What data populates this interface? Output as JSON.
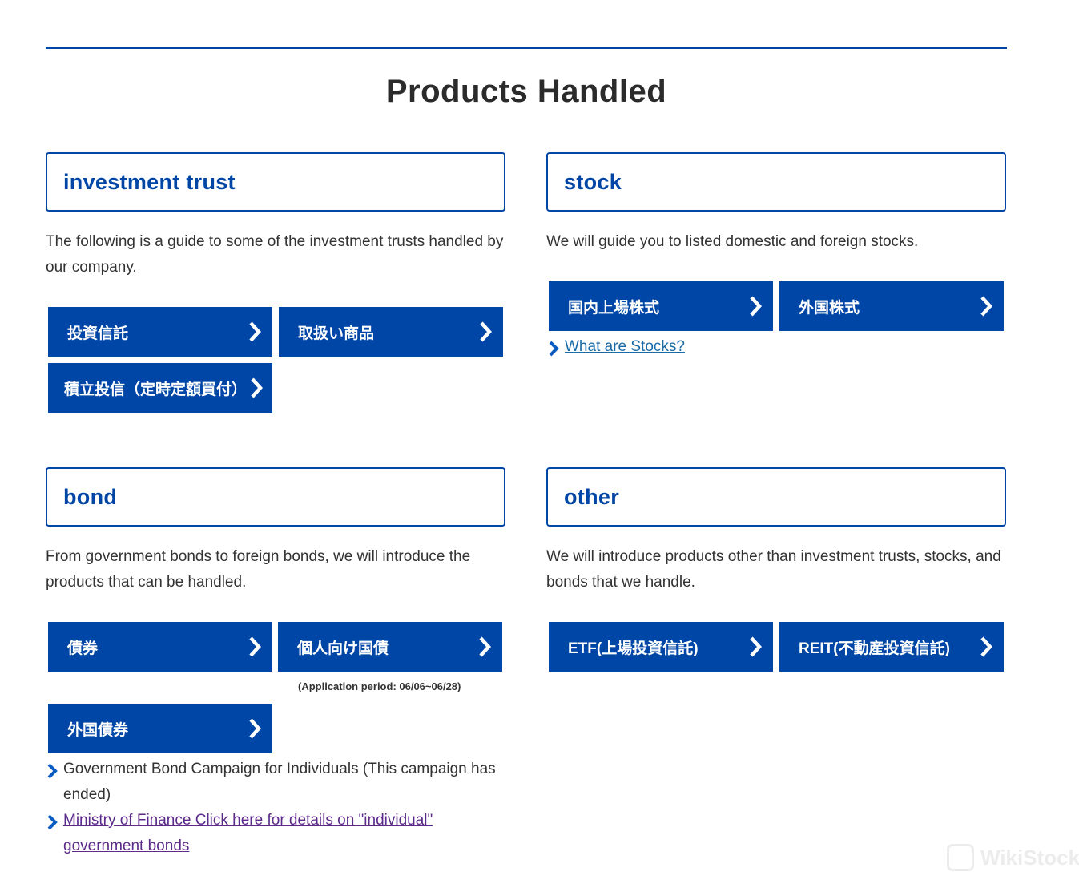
{
  "page": {
    "title": "Products Handled"
  },
  "sections": {
    "investment_trust": {
      "heading": "investment trust",
      "description": "The following is a guide to some of the investment trusts handled by our company.",
      "buttons": [
        "投資信託",
        "取扱い商品",
        "積立投信（定時定額買付）"
      ]
    },
    "stock": {
      "heading": "stock",
      "description": "We will guide you to listed domestic and foreign stocks.",
      "buttons": [
        "国内上場株式",
        "外国株式"
      ],
      "link": "What are Stocks?"
    },
    "bond": {
      "heading": "bond",
      "description": "From government bonds to foreign bonds, we will introduce the products that can be handled.",
      "buttons": [
        "債券",
        "個人向け国債",
        "外国債券"
      ],
      "note": "(Application period: 06/06~06/28)",
      "items": [
        "Government Bond Campaign for Individuals (This campaign has ended)",
        "Ministry of Finance Click here for details on \"individual\" government bonds"
      ]
    },
    "other": {
      "heading": "other",
      "description": "We will introduce products other than investment trusts, stocks, and bonds that we handle.",
      "buttons": [
        "ETF(上場投資信託)",
        "REIT(不動産投資信託)"
      ]
    }
  },
  "watermark": "WikiStock",
  "colors": {
    "brand": "#0046a6",
    "link": "#1a6aa6",
    "visited_link": "#5b2a8a"
  }
}
